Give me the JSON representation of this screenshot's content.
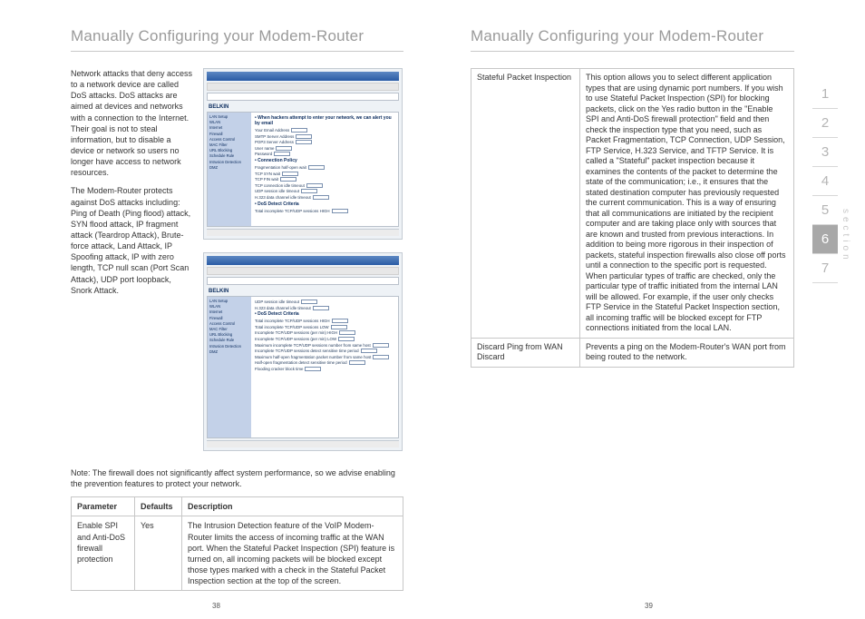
{
  "left": {
    "heading": "Manually Configuring your Modem-Router",
    "para1": "Network attacks that deny access to a network device are called DoS attacks. DoS attacks are aimed at devices and networks with a connection to the Internet. Their goal is not to steal information, but to disable a device or network so users no longer have access to network resources.",
    "para2": "The Modem-Router protects against DoS attacks including: Ping of Death (Ping flood) attack, SYN flood attack, IP fragment attack (Teardrop Attack), Brute-force attack, Land Attack, IP Spoofing attack, IP with zero length, TCP null scan (Port Scan Attack), UDP port loopback, Snork Attack.",
    "note": "Note: The firewall does not significantly affect system performance, so we advise enabling the prevention features to protect your network.",
    "table": {
      "headers": {
        "param": "Parameter",
        "defaults": "Defaults",
        "desc": "Description"
      },
      "rows": [
        {
          "param": "Enable SPI and Anti-DoS firewall protection",
          "defaults": "Yes",
          "desc": "The Intrusion Detection feature of the VoIP Modem-Router limits the access of incoming traffic at the WAN port. When the Stateful Packet Inspection (SPI) feature is turned on, all incoming packets will be blocked except those types marked with a check in the Stateful Packet Inspection section at the top of the screen."
        }
      ]
    },
    "shot1": {
      "logo": "BELKIN",
      "side": [
        "LAN Setup",
        "WLAN",
        "Internet",
        "Firewall",
        "Access Control",
        "MAC Filter",
        "URL Blocking",
        "Schedule Rule",
        "Intrusion Detection",
        "DMZ"
      ],
      "hdr": "• When hackers attempt to enter your network, we can alert you by email",
      "rows": [
        "Your Email Address",
        "SMTP Server Address",
        "POP3 Server Address",
        "User name",
        "Password",
        "• Connection Policy",
        "Fragmentation half-open wait",
        "TCP SYN wait",
        "TCP FIN wait",
        "TCP connection idle timeout",
        "UDP session idle timeout",
        "H.323 data channel idle timeout",
        "• DoS Detect Criteria",
        "Total incomplete TCP/UDP sessions HIGH"
      ]
    },
    "shot2": {
      "logo": "BELKIN",
      "side": [
        "LAN Setup",
        "WLAN",
        "Internet",
        "Firewall",
        "Access Control",
        "MAC Filter",
        "URL Blocking",
        "Schedule Rule",
        "Intrusion Detection",
        "DMZ"
      ],
      "rows": [
        "UDP session idle timeout",
        "H.323 data channel idle timeout",
        "• DoS Detect Criteria",
        "Total incomplete TCP/UDP sessions HIGH",
        "Total incomplete TCP/UDP sessions LOW",
        "Incomplete TCP/UDP sessions (per min) HIGH",
        "Incomplete TCP/UDP sessions (per min) LOW",
        "Maximum incomplete TCP/UDP sessions number from same host",
        "Incomplete TCP/UDP sessions detect sensitive time period",
        "Maximum half-open fragmentation packet number from same host",
        "Half-open fragmentation detect sensitive time period",
        "Flooding cracker block time"
      ]
    },
    "pagenum": "38"
  },
  "right": {
    "heading": "Manually Configuring your Modem-Router",
    "rows": [
      {
        "c1": "Stateful Packet Inspection",
        "c2": "This option allows you to select different application types that are using dynamic port numbers. If you wish to use Stateful Packet Inspection (SPI) for blocking packets, click on the Yes radio button in the \"Enable SPI and Anti-DoS firewall protection\" field and then check the inspection type that you need, such as Packet Fragmentation, TCP Connection, UDP Session, FTP Service, H.323 Service, and TFTP Service. It is called a \"Stateful\" packet inspection because it examines the contents of the packet to determine the state of the communication; i.e., it ensures that the stated destination computer has previously requested the current communication. This is a way of ensuring that all communications are initiated by the recipient computer and are taking place only with sources that are known and trusted from previous interactions. In addition to being more rigorous in their inspection of packets, stateful inspection firewalls also close off ports until a connection to the specific port is requested.  When particular types of traffic are checked, only the particular type of traffic initiated from the internal LAN will be allowed. For example, if the user only checks FTP Service in the Stateful Packet Inspection section, all incoming traffic will be blocked except for FTP connections initiated from the local LAN."
      },
      {
        "c1": "Discard Ping from WAN Discard",
        "c2": "Prevents a ping on the Modem-Router's WAN port from being routed to the network."
      }
    ],
    "pagenum": "39",
    "nav": [
      "1",
      "2",
      "3",
      "4",
      "5",
      "6",
      "7"
    ],
    "section_label": "section"
  }
}
